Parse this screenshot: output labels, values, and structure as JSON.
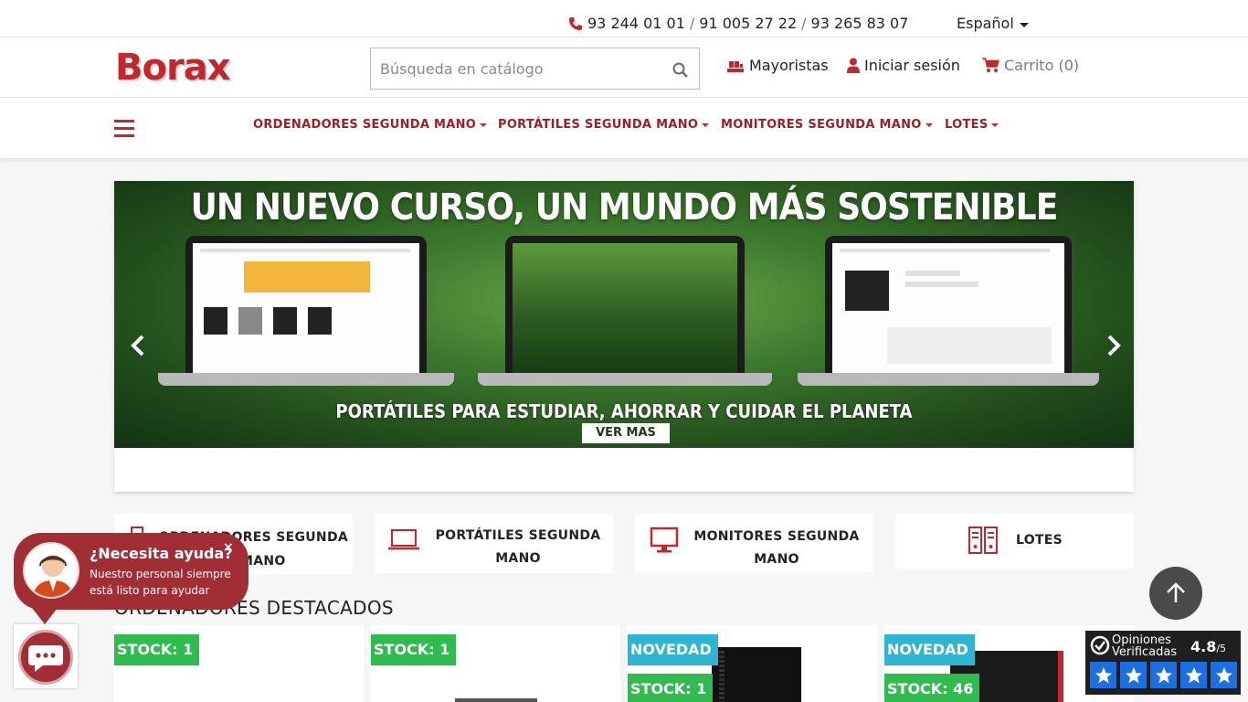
{
  "topbar": {
    "phone1": "93 244 01 01",
    "sep1": "/",
    "phone2": "91 005 27 22",
    "sep2": "/",
    "phone3": "93 265 83 07",
    "language": "Español"
  },
  "header": {
    "logo": "Borax",
    "search_placeholder": "Búsqueda en catálogo",
    "mayoristas": "Mayoristas",
    "login": "Iniciar sesión",
    "cart": "Carrito (0)"
  },
  "nav": {
    "items": [
      {
        "label": "ORDENADORES SEGUNDA MANO"
      },
      {
        "label": "PORTÁTILES SEGUNDA MANO"
      },
      {
        "label": "MONITORES SEGUNDA MANO"
      },
      {
        "label": "LOTES"
      }
    ]
  },
  "banner": {
    "title": "UN NUEVO CURSO, UN MUNDO MÁS SOSTENIBLE",
    "subtitle": "PORTÁTILES PARA ESTUDIAR, AHORRAR Y CUIDAR EL PLANETA",
    "cta": "VER MAS"
  },
  "categories": [
    {
      "line1": "ORDENADORES SEGUNDA",
      "line2": "MANO",
      "icon": "desktop-tower-icon"
    },
    {
      "line1": "PORTÁTILES SEGUNDA",
      "line2": "MANO",
      "icon": "laptop-icon"
    },
    {
      "line1": "MONITORES SEGUNDA",
      "line2": "MANO",
      "icon": "monitor-icon"
    },
    {
      "line1": "LOTES",
      "line2": "",
      "icon": "server-rack-icon"
    }
  ],
  "section_title": "ORDENADORES DESTACADOS",
  "products": [
    {
      "badges": [
        "STOCK: 1"
      ]
    },
    {
      "badges": [
        "STOCK: 1"
      ]
    },
    {
      "badges": [
        "NOVEDAD",
        "STOCK: 1"
      ]
    },
    {
      "badges": [
        "NOVEDAD",
        "STOCK: 46"
      ]
    }
  ],
  "chat": {
    "title": "¿Necesita ayuda?",
    "text": "Nuestro personal siempre está listo para ayudar",
    "close": "×"
  },
  "reviews": {
    "line1": "Opiniones",
    "line2": "Verificadas",
    "score": "4.8",
    "scale": "/5",
    "stars": 5
  },
  "colors": {
    "brand_red": "#c0282e",
    "stock_green": "#2fbb4e",
    "novedad_blue": "#2fb5d2"
  }
}
